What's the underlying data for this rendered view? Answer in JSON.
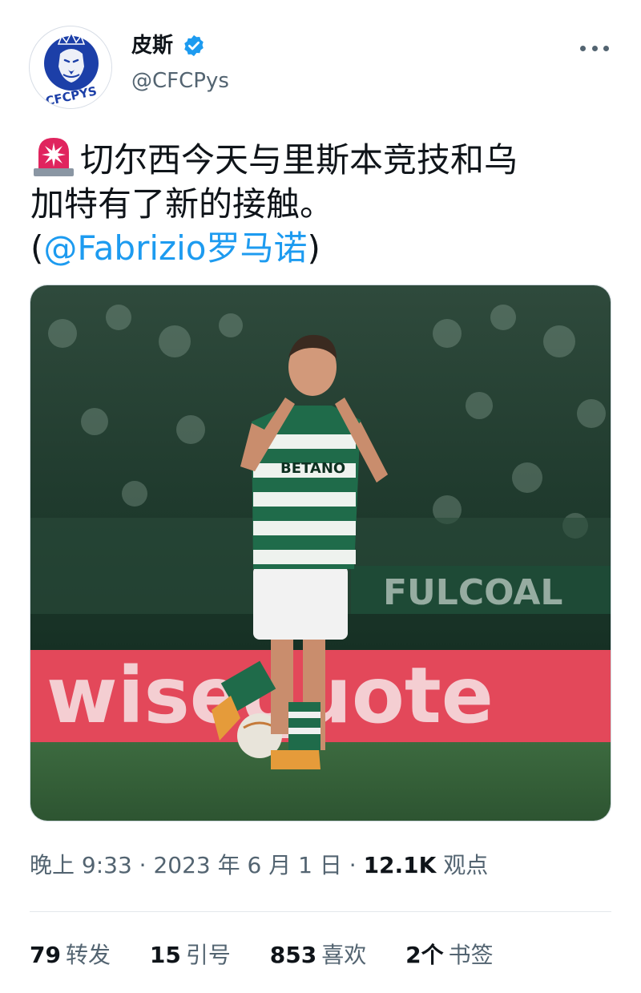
{
  "account": {
    "display_name": "皮斯",
    "handle": "@CFCPys",
    "avatar_text": "CFCPYS",
    "verified": true
  },
  "tweet": {
    "emoji": "siren-icon",
    "text_line1": "切尔西今天与里斯本竞技和乌",
    "text_line2": "加特有了新的接触。",
    "open_paren": "(",
    "mention": "@Fabrizio罗马诺",
    "close_paren": ")"
  },
  "media": {
    "description_icon": "photo-football-player",
    "ad_board_text": "wisequote",
    "sponsor_text": "BETANO"
  },
  "meta": {
    "time": "晚上 9:33",
    "sep1": " · ",
    "date": "2023 年 6 月 1 日",
    "sep2": " · ",
    "views_count": "12.1K",
    "views_label": "观点"
  },
  "stats": {
    "retweets_count": "79",
    "retweets_label": "转发",
    "quotes_count": "15",
    "quotes_label": "引号",
    "likes_count": "853",
    "likes_label": "喜欢",
    "bookmarks_count": "2个",
    "bookmarks_label": "书签"
  },
  "colors": {
    "link": "#1d9bf0",
    "secondary_text": "#536471",
    "verified_badge": "#1d9bf0",
    "kit_green": "#1f6b4a"
  }
}
